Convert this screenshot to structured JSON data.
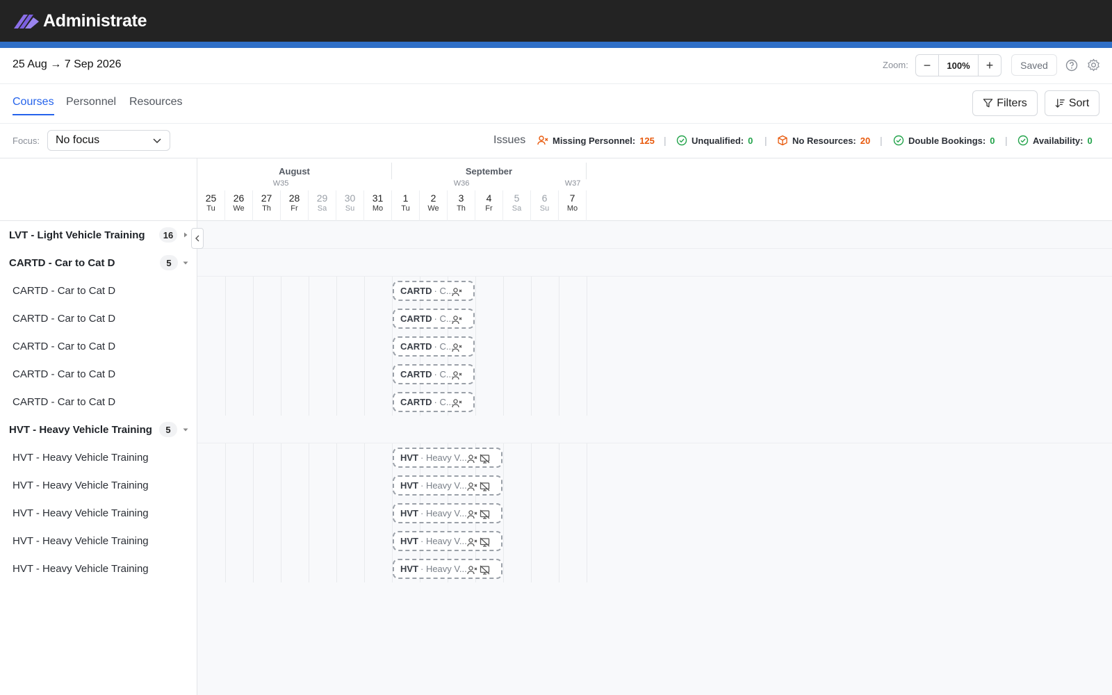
{
  "brand": {
    "name": "Administrate"
  },
  "toolbar": {
    "date_range": "25 Aug → 7 Sep 2026",
    "zoom_label": "Zoom:",
    "zoom_value": "100%",
    "zoom_out": "−",
    "zoom_in": "+",
    "saved_label": "Saved"
  },
  "tabs": [
    {
      "label": "Courses",
      "active": true
    },
    {
      "label": "Personnel",
      "active": false
    },
    {
      "label": "Resources",
      "active": false
    }
  ],
  "actions": {
    "filters_label": "Filters",
    "sort_label": "Sort"
  },
  "focus": {
    "label": "Focus:",
    "value": "No focus"
  },
  "issues": {
    "label": "Issues",
    "items": [
      {
        "label": "Missing Personnel:",
        "count": "125",
        "status": "bad",
        "icon": "person-x-icon"
      },
      {
        "label": "Unqualified:",
        "count": "0",
        "status": "good",
        "icon": "check-circle-icon"
      },
      {
        "label": "No Resources:",
        "count": "20",
        "status": "bad",
        "icon": "box-x-icon"
      },
      {
        "label": "Double Bookings:",
        "count": "0",
        "status": "good",
        "icon": "check-circle-icon"
      },
      {
        "label": "Availability:",
        "count": "0",
        "status": "good",
        "icon": "check-circle-icon"
      }
    ]
  },
  "calendar": {
    "months": [
      "August",
      "September"
    ],
    "weeks": [
      "W35",
      "W36",
      "W37"
    ],
    "days": [
      {
        "num": "25",
        "dow": "Tu",
        "weekend": false
      },
      {
        "num": "26",
        "dow": "We",
        "weekend": false
      },
      {
        "num": "27",
        "dow": "Th",
        "weekend": false
      },
      {
        "num": "28",
        "dow": "Fr",
        "weekend": false
      },
      {
        "num": "29",
        "dow": "Sa",
        "weekend": true
      },
      {
        "num": "30",
        "dow": "Su",
        "weekend": true
      },
      {
        "num": "31",
        "dow": "Mo",
        "weekend": false
      },
      {
        "num": "1",
        "dow": "Tu",
        "weekend": false
      },
      {
        "num": "2",
        "dow": "We",
        "weekend": false
      },
      {
        "num": "3",
        "dow": "Th",
        "weekend": false
      },
      {
        "num": "4",
        "dow": "Fr",
        "weekend": false
      },
      {
        "num": "5",
        "dow": "Sa",
        "weekend": true
      },
      {
        "num": "6",
        "dow": "Su",
        "weekend": true
      },
      {
        "num": "7",
        "dow": "Mo",
        "weekend": false
      }
    ]
  },
  "groups": [
    {
      "title": "LVT - Light Vehicle Training",
      "count": "16",
      "expanded": false,
      "rows": []
    },
    {
      "title": "CARTD - Car to Cat D",
      "count": "5",
      "expanded": true,
      "rows": [
        {
          "label": "CARTD - Car to Cat D",
          "event_code": "CARTD",
          "event_sub": "· C...",
          "issues": [
            "person-x-icon"
          ]
        },
        {
          "label": "CARTD - Car to Cat D",
          "event_code": "CARTD",
          "event_sub": "· C...",
          "issues": [
            "person-x-icon"
          ]
        },
        {
          "label": "CARTD - Car to Cat D",
          "event_code": "CARTD",
          "event_sub": "· C...",
          "issues": [
            "person-x-icon"
          ]
        },
        {
          "label": "CARTD - Car to Cat D",
          "event_code": "CARTD",
          "event_sub": "· C...",
          "issues": [
            "person-x-icon"
          ]
        },
        {
          "label": "CARTD - Car to Cat D",
          "event_code": "CARTD",
          "event_sub": "· C...",
          "issues": [
            "person-x-icon"
          ]
        }
      ]
    },
    {
      "title": "HVT - Heavy Vehicle Training",
      "count": "5",
      "expanded": true,
      "rows": [
        {
          "label": "HVT - Heavy Vehicle Training",
          "event_code": "HVT",
          "event_sub": "· Heavy V...",
          "issues": [
            "person-x-icon",
            "screen-off-icon"
          ]
        },
        {
          "label": "HVT - Heavy Vehicle Training",
          "event_code": "HVT",
          "event_sub": "· Heavy V...",
          "issues": [
            "person-x-icon",
            "screen-off-icon"
          ]
        },
        {
          "label": "HVT - Heavy Vehicle Training",
          "event_code": "HVT",
          "event_sub": "· Heavy V...",
          "issues": [
            "person-x-icon",
            "screen-off-icon"
          ]
        },
        {
          "label": "HVT - Heavy Vehicle Training",
          "event_code": "HVT",
          "event_sub": "· Heavy V...",
          "issues": [
            "person-x-icon",
            "screen-off-icon"
          ]
        },
        {
          "label": "HVT - Heavy Vehicle Training",
          "event_code": "HVT",
          "event_sub": "· Heavy V...",
          "issues": [
            "person-x-icon",
            "screen-off-icon"
          ]
        }
      ]
    }
  ],
  "colors": {
    "accent": "#2563eb",
    "brandbar": "#232323",
    "stripe": "#2f6fc7",
    "bad": "#e8590c",
    "good": "#22a34a"
  }
}
